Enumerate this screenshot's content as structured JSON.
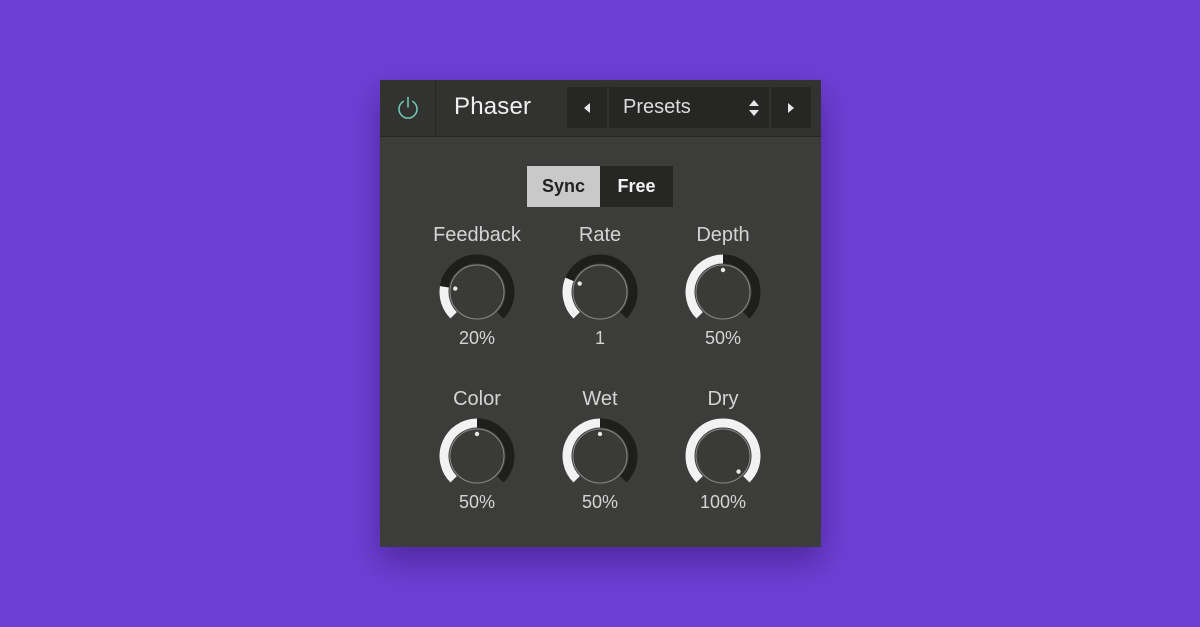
{
  "plugin": {
    "title": "Phaser",
    "presets_label": "Presets"
  },
  "mode": {
    "options": [
      "Sync",
      "Free"
    ],
    "selected": "Sync"
  },
  "colors": {
    "background": "#6e3fd4",
    "panel": "#3c3c3a",
    "header": "#323230",
    "control_dark": "#262625",
    "power_icon": "#6fc6b4",
    "knob_arc": "#f2f2f2",
    "knob_track": "#1e1e1d"
  },
  "knobs": [
    {
      "label": "Feedback",
      "value": "20%",
      "fraction": 0.2
    },
    {
      "label": "Rate",
      "value": "1",
      "fraction": 0.25
    },
    {
      "label": "Depth",
      "value": "50%",
      "fraction": 0.5
    },
    {
      "label": "Color",
      "value": "50%",
      "fraction": 0.5
    },
    {
      "label": "Wet",
      "value": "50%",
      "fraction": 0.5
    },
    {
      "label": "Dry",
      "value": "100%",
      "fraction": 1.0
    }
  ],
  "icons": [
    "power-icon",
    "chevron-left-icon",
    "chevron-right-icon",
    "updown-arrows-icon"
  ]
}
